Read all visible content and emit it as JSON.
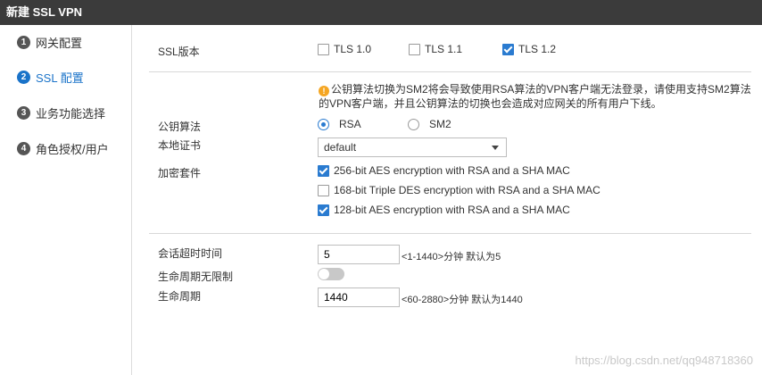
{
  "window": {
    "title": "新建 SSL VPN"
  },
  "steps": [
    {
      "num": "1",
      "label": "网关配置"
    },
    {
      "num": "2",
      "label": "SSL 配置"
    },
    {
      "num": "3",
      "label": "业务功能选择"
    },
    {
      "num": "4",
      "label": "角色授权/用户"
    }
  ],
  "ssl_version": {
    "label": "SSL版本",
    "options": [
      {
        "label": "TLS 1.0",
        "checked": false
      },
      {
        "label": "TLS 1.1",
        "checked": false
      },
      {
        "label": "TLS 1.2",
        "checked": true
      }
    ]
  },
  "warning": {
    "icon": "!",
    "text": "公钥算法切换为SM2将会导致使用RSA算法的VPN客户端无法登录，请使用支持SM2算法的VPN客户端，并且公钥算法的切换也会造成对应网关的所有用户下线。"
  },
  "pubkey": {
    "label": "公钥算法",
    "options": [
      {
        "label": "RSA",
        "checked": true
      },
      {
        "label": "SM2",
        "checked": false
      }
    ]
  },
  "local_cert": {
    "label": "本地证书",
    "value": "default"
  },
  "cipher": {
    "label": "加密套件",
    "options": [
      {
        "label": "256-bit AES encryption with RSA and a SHA MAC",
        "checked": true
      },
      {
        "label": "168-bit Triple DES encryption with RSA and a SHA MAC",
        "checked": false
      },
      {
        "label": "128-bit AES encryption with RSA and a SHA MAC",
        "checked": true
      }
    ]
  },
  "session_timeout": {
    "label": "会话超时时间",
    "value": "5",
    "hint": "<1-1440>分钟 默认为5"
  },
  "lifetime_unlimited": {
    "label": "生命周期无限制",
    "enabled": false
  },
  "lifetime": {
    "label": "生命周期",
    "value": "1440",
    "hint": "<60-2880>分钟 默认为1440"
  },
  "watermark": "https://blog.csdn.net/qq948718360"
}
